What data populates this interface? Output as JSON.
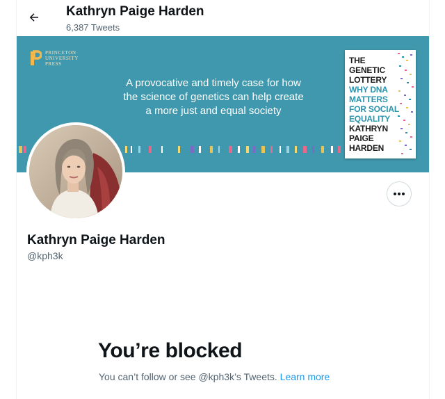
{
  "header": {
    "back_icon": "arrow-left-icon",
    "name": "Kathryn Paige Harden",
    "tweet_count": "6,387 Tweets"
  },
  "banner": {
    "publisher_lines": [
      "PRINCETON",
      "UNIVERSITY",
      "PRESS"
    ],
    "tagline": "A provocative and timely case for how the science of genetics can help create a more just and equal society",
    "book_title_dark": [
      "THE",
      "GENETIC",
      "LOTTERY"
    ],
    "book_title_teal": [
      "WHY DNA",
      "MATTERS",
      "FOR SOCIAL",
      "EQUALITY"
    ],
    "book_author": [
      "KATHRYN",
      "PAIGE",
      "HARDEN"
    ],
    "background_color": "#3f98ad"
  },
  "profile": {
    "name": "Kathryn Paige Harden",
    "handle": "@kph3k",
    "more_icon": "ellipsis-icon"
  },
  "blocked": {
    "title": "You’re blocked",
    "message": "You can’t follow or see @kph3k’s Tweets.",
    "learn_more": "Learn more",
    "link_color": "#1d9bf0"
  }
}
